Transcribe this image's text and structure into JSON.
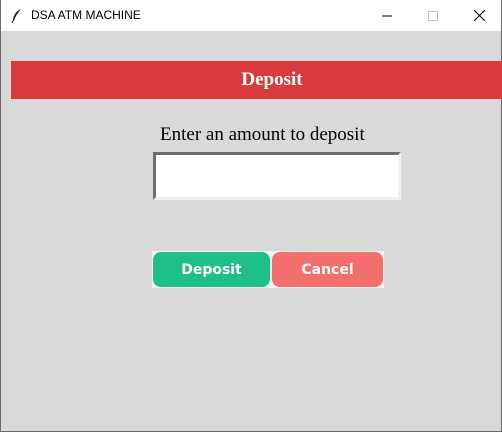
{
  "window": {
    "title": "DSA ATM MACHINE"
  },
  "header": {
    "title": "Deposit",
    "color": "#d83a3d"
  },
  "form": {
    "prompt": "Enter an amount to deposit",
    "amount_value": "",
    "amount_placeholder": ""
  },
  "actions": {
    "deposit_label": "Deposit",
    "cancel_label": "Cancel",
    "deposit_color": "#1fbf8a",
    "cancel_color": "#f36f6c"
  },
  "icons": {
    "app": "feather-icon",
    "minimize": "minimize-icon",
    "maximize": "maximize-icon",
    "close": "close-icon"
  }
}
